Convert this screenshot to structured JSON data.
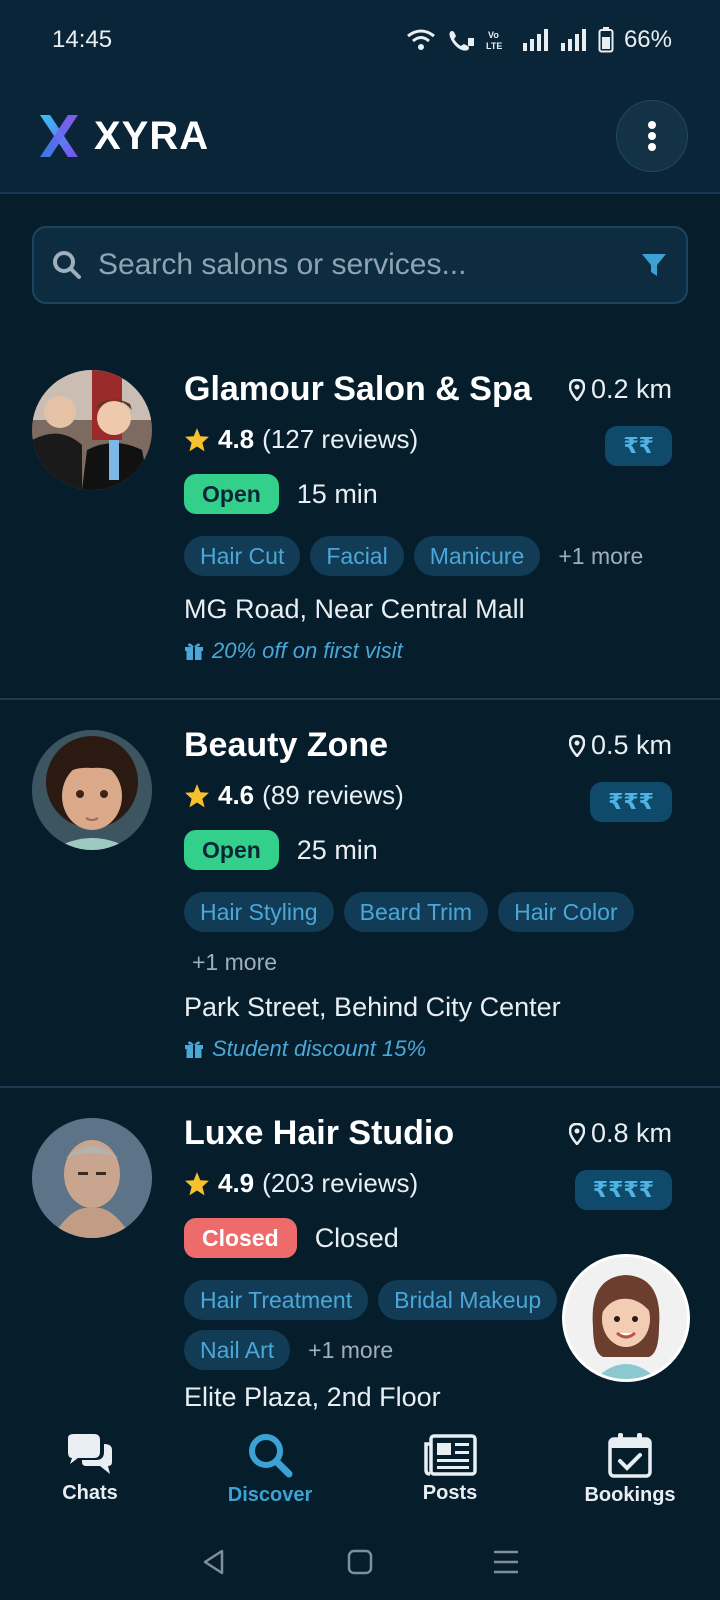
{
  "status_bar": {
    "time": "14:45",
    "battery": "66%"
  },
  "app": {
    "brand": "XYRA"
  },
  "search": {
    "placeholder": "Search salons or services..."
  },
  "salons": [
    {
      "name": "Glamour Salon & Spa",
      "distance": "0.2 km",
      "rating": "4.8",
      "reviews": "(127 reviews)",
      "price": "₹₹",
      "status": "Open",
      "eta": "15 min",
      "tags": [
        "Hair Cut",
        "Facial",
        "Manicure"
      ],
      "more": "+1 more",
      "address": "MG Road, Near Central Mall",
      "offer": "20% off on first visit"
    },
    {
      "name": "Beauty Zone",
      "distance": "0.5 km",
      "rating": "4.6",
      "reviews": "(89 reviews)",
      "price": "₹₹₹",
      "status": "Open",
      "eta": "25 min",
      "tags": [
        "Hair Styling",
        "Beard Trim",
        "Hair Color"
      ],
      "more": "+1 more",
      "address": "Park Street, Behind City Center",
      "offer": "Student discount 15%"
    },
    {
      "name": "Luxe Hair Studio",
      "distance": "0.8 km",
      "rating": "4.9",
      "reviews": "(203 reviews)",
      "price": "₹₹₹₹",
      "status": "Closed",
      "eta": "Closed",
      "tags": [
        "Hair Treatment",
        "Bridal Makeup",
        "Nail Art"
      ],
      "more": "+1 more",
      "address": "Elite Plaza, 2nd Floor"
    }
  ],
  "nav": {
    "chats": "Chats",
    "discover": "Discover",
    "posts": "Posts",
    "bookings": "Bookings"
  },
  "colors": {
    "accent": "#3aa3d4",
    "open": "#33d08c",
    "closed": "#ee6b6b",
    "background": "#061d2c"
  }
}
